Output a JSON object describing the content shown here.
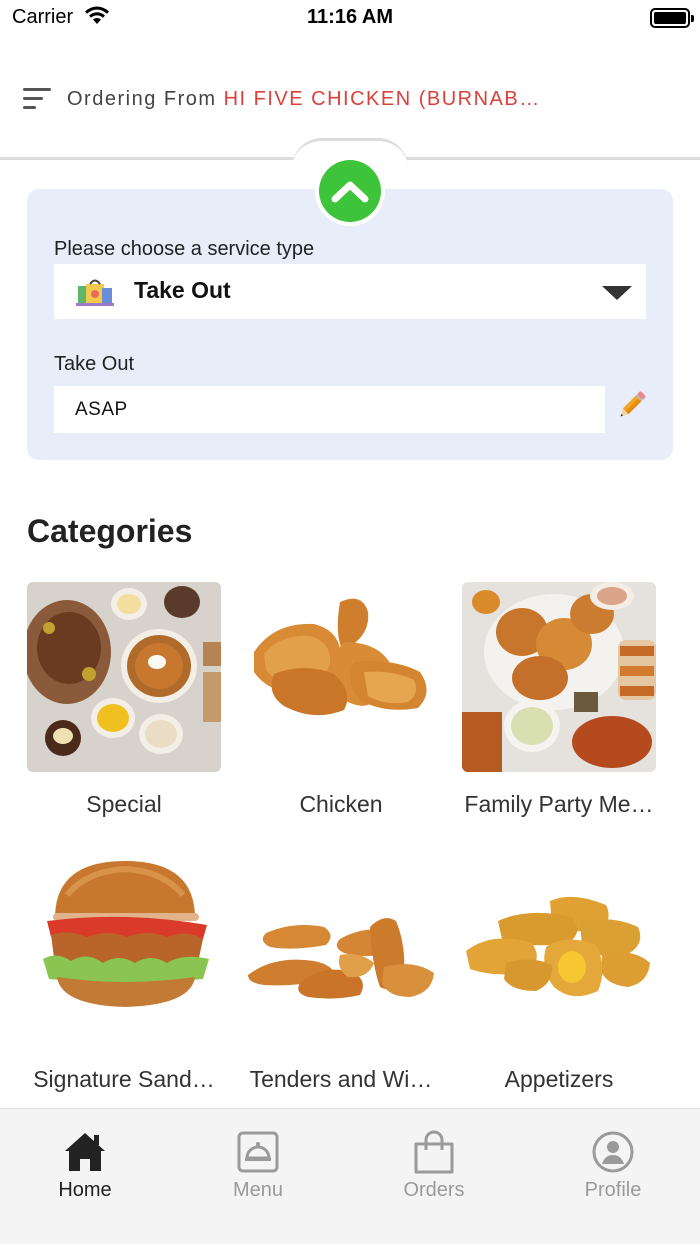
{
  "status_bar": {
    "carrier": "Carrier",
    "time": "11:16 AM"
  },
  "header": {
    "ordering_prefix": "Ordering From ",
    "store_name": "HI FIVE CHICKEN (BURNAB…"
  },
  "service": {
    "prompt": "Please choose a service type",
    "selected": "Take Out",
    "time_label": "Take Out",
    "time_value": "ASAP"
  },
  "categories": {
    "heading": "Categories",
    "items": [
      {
        "label": "Special"
      },
      {
        "label": "Chicken"
      },
      {
        "label": "Family Party Me…"
      },
      {
        "label": "Signature Sand…"
      },
      {
        "label": "Tenders and Wi…"
      },
      {
        "label": "Appetizers"
      }
    ]
  },
  "tab_bar": {
    "tabs": [
      {
        "label": "Home",
        "icon": "home-icon",
        "active": true
      },
      {
        "label": "Menu",
        "icon": "menu-cloche-icon",
        "active": false
      },
      {
        "label": "Orders",
        "icon": "shopping-bag-icon",
        "active": false
      },
      {
        "label": "Profile",
        "icon": "profile-icon",
        "active": false
      }
    ]
  },
  "colors": {
    "accent_red": "#d9413a",
    "toggle_green": "#3ec43a",
    "card_background": "#e7edf9",
    "tab_bar_background": "#f4f4f4"
  }
}
